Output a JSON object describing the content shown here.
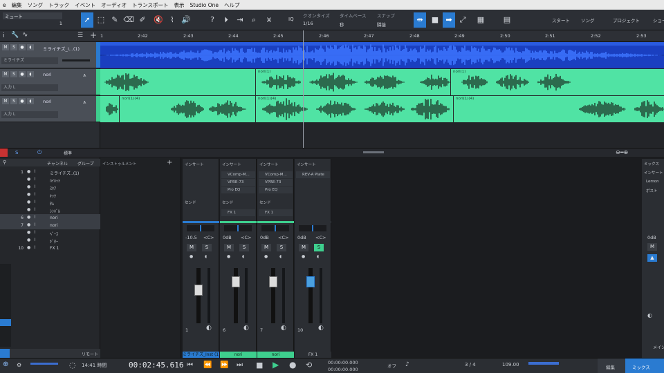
{
  "menubar": {
    "items": [
      "e",
      "編集",
      "ソング",
      "トラック",
      "イベント",
      "オーディオ",
      "トランスポート",
      "表示",
      "Studio One",
      "ヘルプ"
    ]
  },
  "toolbar": {
    "track_label": "ミュート",
    "track_num": "1",
    "iq": "IQ",
    "quantize_label": "クオンタイズ",
    "quantize_value": "1/16",
    "timebase_label": "タイムベース",
    "timebase_value": "秒",
    "snap_label": "スナップ",
    "snap_value": "隣接",
    "start": "スタート",
    "song": "ソング",
    "project": "プロジェクト",
    "screen": "ショー"
  },
  "ruler": {
    "ticks": [
      "2:42",
      "2:43",
      "2:44",
      "2:45",
      "2:46",
      "2:47",
      "2:48",
      "2:49",
      "2:50",
      "2:51",
      "2:52",
      "2:53"
    ]
  },
  "tracks": [
    {
      "name": "ミライチズ_I...(1)",
      "sub": "ミライチズ"
    },
    {
      "name": "nori",
      "sub": "入力 L"
    },
    {
      "name": "nori",
      "sub": "入力 L"
    }
  ],
  "clips": {
    "lane2": [
      "nori(1)",
      "nori(1)"
    ],
    "lane3": [
      "nori(1)(4)",
      "nori(1)(4)",
      "nori(1)(4)"
    ]
  },
  "console": {
    "tabs": {
      "channel": "チャンネル",
      "group": "グループ",
      "instrument": "インストゥルメント",
      "standard": "標準"
    },
    "list": [
      {
        "num": "1",
        "name": "ミライチズ..(1)"
      },
      {
        "num": "",
        "name": "ﾊｲﾊｯﾄ"
      },
      {
        "num": "",
        "name": "ｽﾈｱ"
      },
      {
        "num": "",
        "name": "ｷｯｸ"
      },
      {
        "num": "",
        "name": "ﾀﾑ"
      },
      {
        "num": "",
        "name": "ｼﾝﾊﾞﾙ"
      },
      {
        "num": "6",
        "name": "nori"
      },
      {
        "num": "7",
        "name": "nori"
      },
      {
        "num": "",
        "name": "ﾍﾞｰｽ"
      },
      {
        "num": "",
        "name": "ｷﾞﾀｰ"
      },
      {
        "num": "10",
        "name": "FX 1"
      }
    ],
    "strips": [
      {
        "insert": "インサート",
        "send": "センド",
        "slots": [],
        "sends": [],
        "vol": "-10.5",
        "pan": "<C>",
        "num": "1",
        "name": "ミライチズ_Inst (1)",
        "name_color": "#2a7bd1"
      },
      {
        "insert": "インサート",
        "send": "センド",
        "slots": [
          "VComp-M...",
          "VPRE-73",
          "Pro EQ"
        ],
        "sends": [
          "FX 1"
        ],
        "vol": "0dB",
        "pan": "<C>",
        "num": "6",
        "name": "nori",
        "name_color": "#3ecf8e"
      },
      {
        "insert": "インサート",
        "send": "センド",
        "slots": [
          "VComp-M...",
          "VPRE-73",
          "Pro EQ"
        ],
        "sends": [
          "FX 1"
        ],
        "vol": "0dB",
        "pan": "<C>",
        "num": "7",
        "name": "nori",
        "name_color": "#3ecf8e"
      },
      {
        "insert": "インサート",
        "send": "",
        "slots": [
          "REV-A Plate"
        ],
        "sends": [],
        "vol": "0dB",
        "pan": "<C>",
        "num": "10",
        "name": "FX 1",
        "name_color": "#2b2e33"
      }
    ],
    "right": {
      "insert": "インサート",
      "mix": "ミックス",
      "slot": "Lemon",
      "post": "ポスト",
      "vol": "0dB",
      "out": "メイン"
    }
  },
  "transport": {
    "time": "00:02:45.616",
    "sr_time": "14:41 時間",
    "sr_label": "秒",
    "start_pos": "00:00:00.000",
    "end_pos": "00:00:00.000",
    "off": "オフ",
    "meter": "3 / 4",
    "tempo": "109.00",
    "edit": "編集",
    "mix": "ミックス",
    "bottom_label": "リモート"
  },
  "colors": {
    "accent": "#2a7bd1",
    "clip_green": "#50e3a4",
    "wave_dark": "#2c6b4e",
    "wave_blue": "#1a3fc0"
  }
}
